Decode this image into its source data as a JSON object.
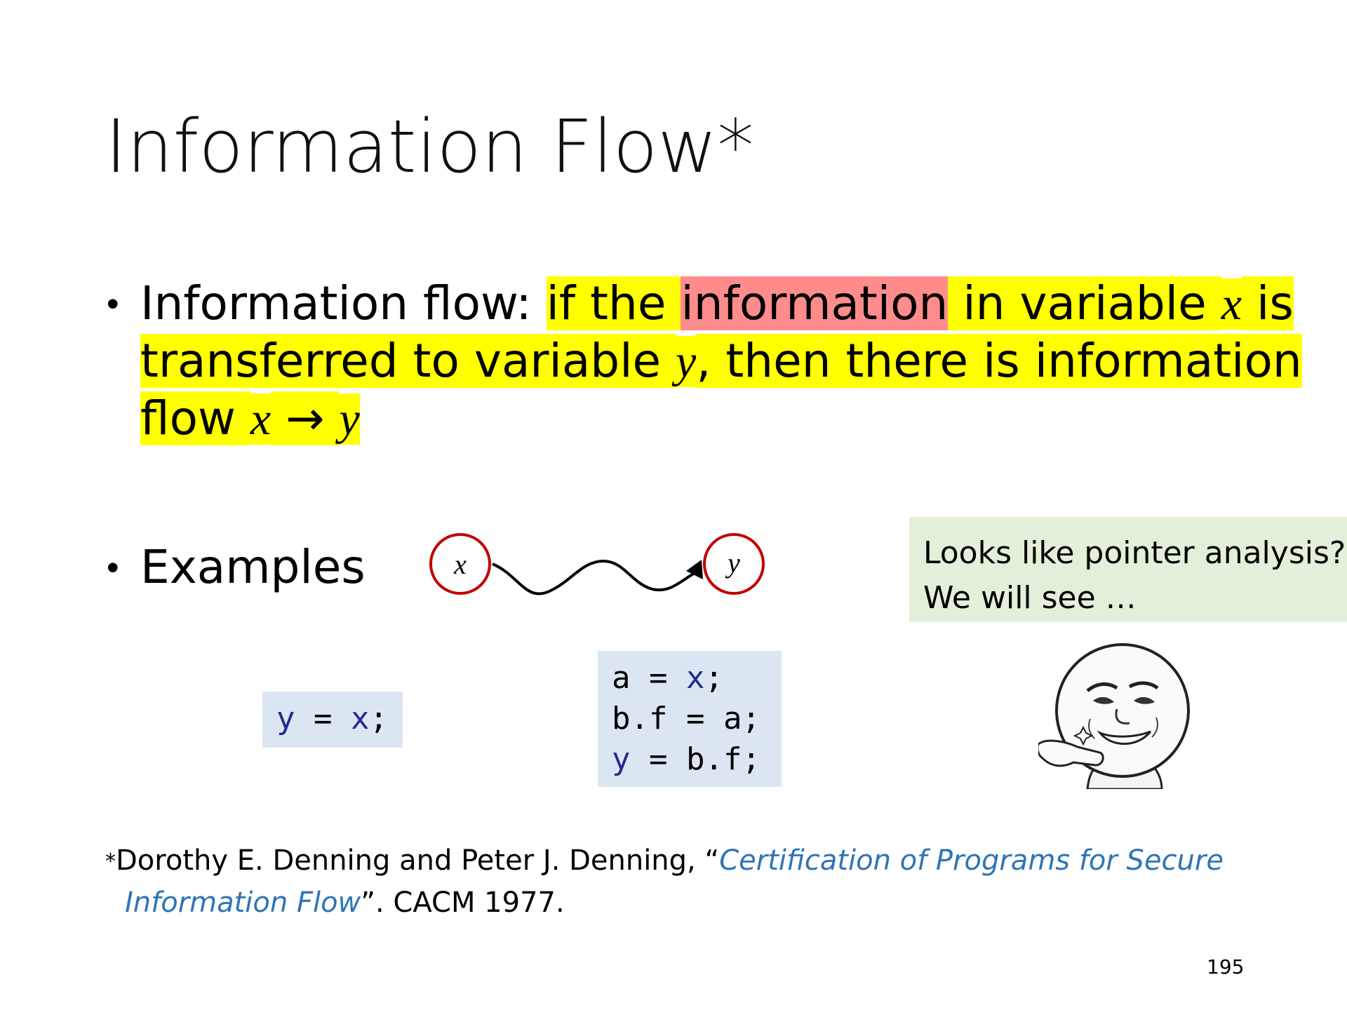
{
  "slide": {
    "title": "Information Flow*",
    "bullet1": {
      "prefix": "Information flow: ",
      "hl_if_the": "if the ",
      "hl_information": "information",
      "hl_rest1": " in variable ",
      "var_x": "x",
      "hl_is": " is",
      "line2_a": "transferred to variable ",
      "var_y": "y",
      "line2_b": ", then there is information",
      "line3_a": "flow ",
      "line3_x": "x",
      "line3_arrow": " → ",
      "line3_y": "y"
    },
    "bullet2": {
      "label": "Examples"
    },
    "diagram": {
      "node_x": "x",
      "node_y": "y"
    },
    "code1": {
      "lhs": "y",
      "op": " = ",
      "rhs": "x",
      "end": ";"
    },
    "code2": {
      "l1_a": "a = ",
      "l1_b": "x",
      "l1_c": ";",
      "l2": "b.f = a;",
      "l3_a": "y",
      "l3_b": " = b.f;"
    },
    "note": {
      "line1": "Looks like pointer analysis?",
      "line2": "We will see …"
    },
    "footnote": {
      "star": "*",
      "text1": "Dorothy E. Denning and Peter J. Denning, “",
      "link1": "Certification of Programs for Secure",
      "link2": "Information Flow",
      "text2": "”. CACM 1977."
    },
    "page_number": "195",
    "colors": {
      "highlight_yellow": "#ffff00",
      "highlight_red": "#ff8c8c",
      "node_circle": "#c00000",
      "code_bg": "#dce6f2",
      "note_bg": "#e2efd9",
      "link": "#2e75b6"
    }
  }
}
